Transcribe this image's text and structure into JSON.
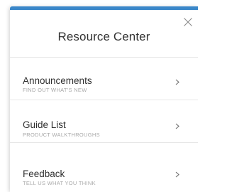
{
  "colors": {
    "accent": "#3a87c9",
    "title_text": "#333333",
    "label_text": "#2f2f2f",
    "subtitle_text": "#a8a8a8",
    "divider": "#e6e6e6"
  },
  "header": {
    "title": "Resource Center",
    "close_icon": "close-icon"
  },
  "items": [
    {
      "label": "Announcements",
      "subtitle": "FIND OUT WHAT'S NEW",
      "icon": "chevron-right-icon"
    },
    {
      "label": "Guide List",
      "subtitle": "PRODUCT WALKTHROUGHS",
      "icon": "chevron-right-icon"
    },
    {
      "label": "Feedback",
      "subtitle": "TELL US WHAT YOU THINK",
      "icon": "chevron-right-icon"
    }
  ]
}
